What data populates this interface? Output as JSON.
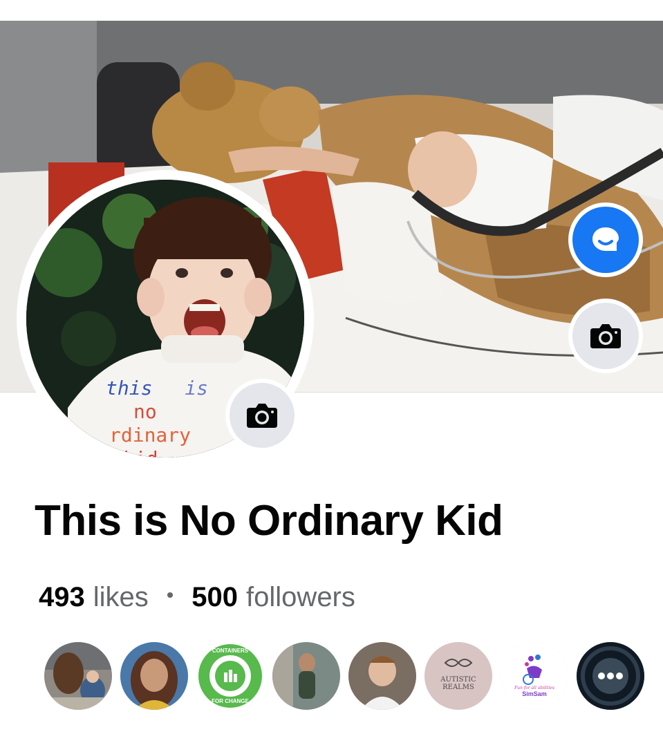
{
  "page": {
    "title": "This is No Ordinary Kid",
    "likes_count": "493",
    "likes_label": "likes",
    "separator": "•",
    "followers_count": "500",
    "followers_label": "followers"
  },
  "profile_picture": {
    "shirt_text": [
      "this",
      "is",
      "no",
      "rdinary",
      "kid"
    ]
  },
  "friends": [
    {
      "name": "friend-1"
    },
    {
      "name": "friend-2"
    },
    {
      "name": "containers-for-change",
      "text_top": "CONTAINERS",
      "text_bottom": "FOR CHANGE"
    },
    {
      "name": "friend-4"
    },
    {
      "name": "friend-5"
    },
    {
      "name": "autistic-realms",
      "line1": "AUTISTIC",
      "line2": "REALMS"
    },
    {
      "name": "simsam",
      "tagline": "Fun for all abilities",
      "label": "SimSam"
    },
    {
      "name": "more",
      "label": "•••"
    }
  ],
  "colors": {
    "messenger_blue": "#1877f2",
    "button_gray": "#e4e6eb",
    "secondary_text": "#65676b"
  },
  "icons": {
    "messenger": "messenger-icon",
    "camera": "camera-icon",
    "more": "more-icon"
  }
}
